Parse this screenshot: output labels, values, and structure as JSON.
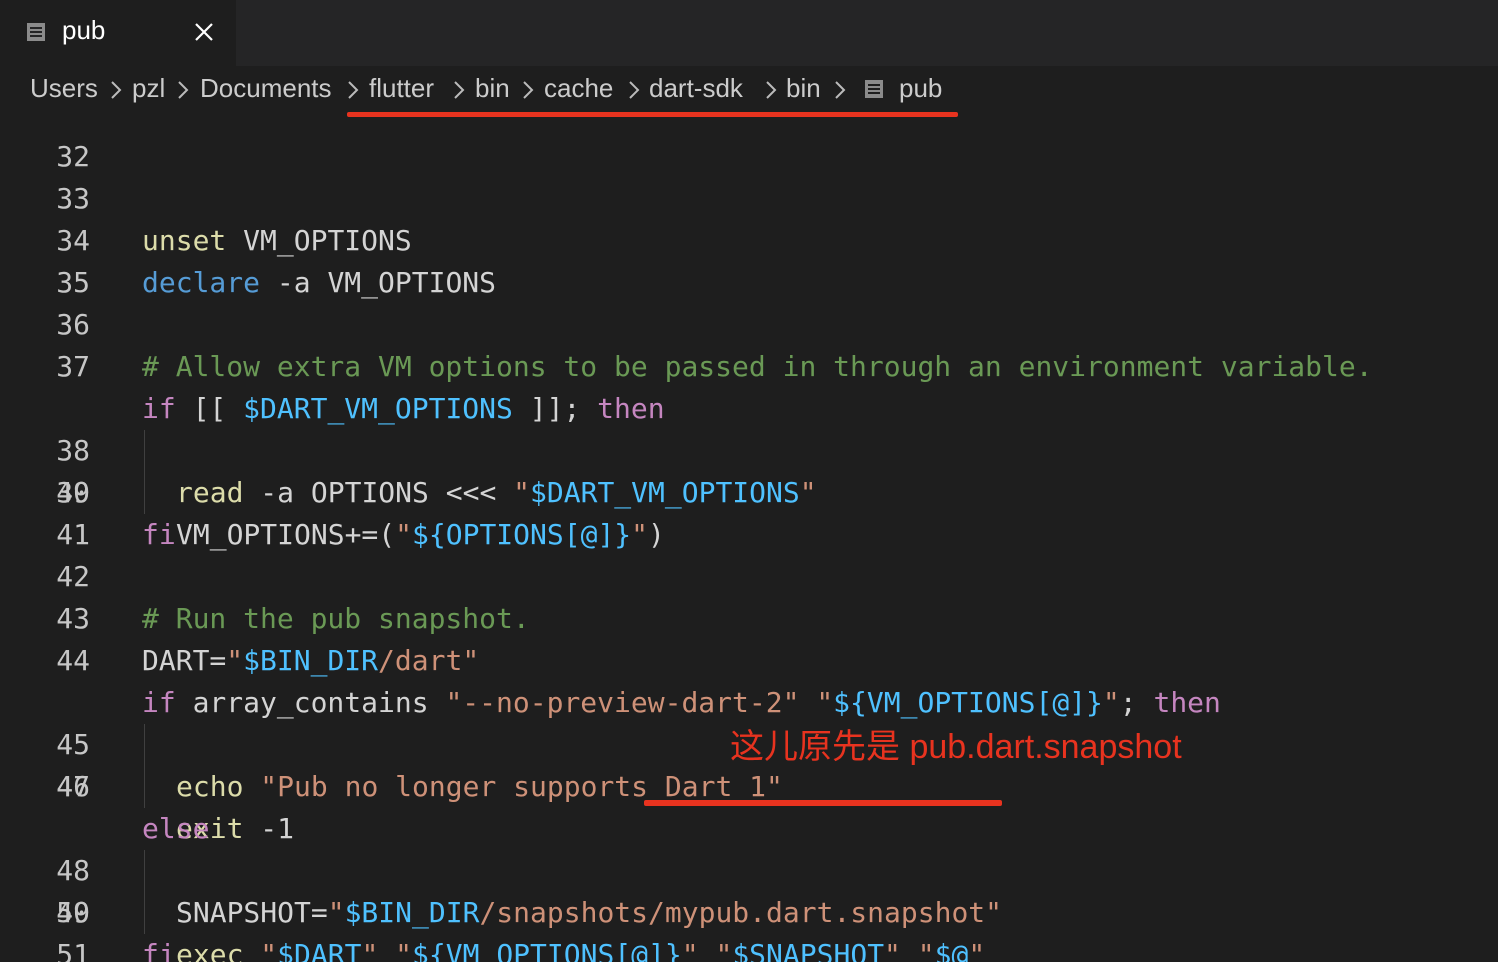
{
  "tab": {
    "label": "pub"
  },
  "breadcrumb": [
    "Users",
    "pzl",
    "Documents",
    "flutter",
    "bin",
    "cache",
    "dart-sdk",
    "bin",
    "pub"
  ],
  "code_lines": [
    {
      "num": "32",
      "code": ""
    },
    {
      "num": "33",
      "code": "unset VM_OPTIONS"
    },
    {
      "num": "34",
      "code": "declare -a VM_OPTIONS"
    },
    {
      "num": "35",
      "code": ""
    },
    {
      "num": "36",
      "code": "# Allow extra VM options to be passed in through an environment variable."
    },
    {
      "num": "37",
      "code": "if [[ $DART_VM_OPTIONS ]]; then"
    },
    {
      "num": "38",
      "code": "read -a OPTIONS <<< \"$DART_VM_OPTIONS\""
    },
    {
      "num": "39",
      "code": "VM_OPTIONS+=(\"${OPTIONS[@]}\")"
    },
    {
      "num": "40",
      "code": "fi"
    },
    {
      "num": "41",
      "code": ""
    },
    {
      "num": "42",
      "code": "# Run the pub snapshot."
    },
    {
      "num": "43",
      "code": "DART=\"$BIN_DIR/dart\""
    },
    {
      "num": "44",
      "code": "if array_contains \"--no-preview-dart-2\" \"${VM_OPTIONS[@]}\"; then"
    },
    {
      "num": "45",
      "code": "echo \"Pub no longer supports Dart 1\""
    },
    {
      "num": "46",
      "code": "exit -1"
    },
    {
      "num": "47",
      "code": "else"
    },
    {
      "num": "48",
      "code": "SNAPSHOT=\"$BIN_DIR/snapshots/mypub.dart.snapshot\""
    },
    {
      "num": "49",
      "code": "exec \"$DART\" \"${VM_OPTIONS[@]}\" \"$SNAPSHOT\" \"$@\""
    },
    {
      "num": "50",
      "code": "fi"
    },
    {
      "num": "51",
      "code": ""
    }
  ],
  "annotation": "这儿原先是 pub.dart.snapshot",
  "colors": {
    "annotation_red": "#e8331f",
    "keyword_control": "#c586c0",
    "keyword_blue": "#569cd6",
    "builtin": "#dcdcaa",
    "string": "#ce9178",
    "variable": "#4fc1ff",
    "comment": "#6a9955"
  },
  "icons": {
    "file": "file-icon",
    "close": "close-icon",
    "separator": "chevron-right-icon"
  }
}
